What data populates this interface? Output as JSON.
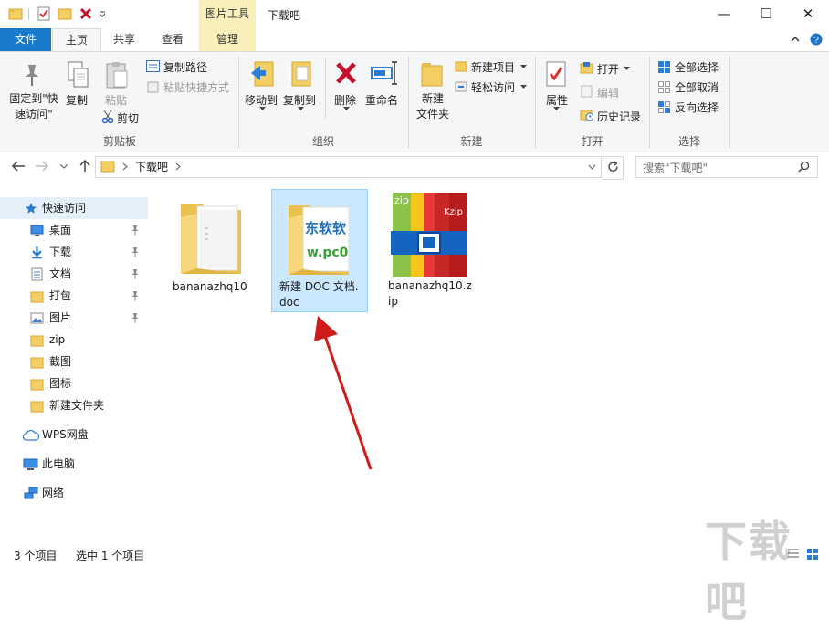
{
  "titlebar": {
    "context_tab": "图片工具",
    "window_title": "下载吧",
    "minimize_glyph": "—",
    "maximize_glyph": "☐",
    "close_glyph": "✕"
  },
  "tabs": {
    "file": "文件",
    "home": "主页",
    "share": "共享",
    "view": "查看",
    "manage": "管理"
  },
  "ribbon": {
    "pin": "固定到\"快速访问\"",
    "copy": "复制",
    "paste": "粘贴",
    "copy_path": "复制路径",
    "paste_shortcut": "粘贴快捷方式",
    "cut": "剪切",
    "group_clipboard": "剪贴板",
    "move_to": "移动到",
    "copy_to": "复制到",
    "delete": "删除",
    "rename": "重命名",
    "group_organize": "组织",
    "new_folder": "新建\n文件夹",
    "new_item": "新建项目",
    "easy_access": "轻松访问",
    "group_new": "新建",
    "properties": "属性",
    "open": "打开",
    "edit": "编辑",
    "history": "历史记录",
    "group_open": "打开",
    "select_all": "全部选择",
    "select_none": "全部取消",
    "invert_selection": "反向选择",
    "group_select": "选择"
  },
  "address": {
    "path": "下载吧",
    "search_placeholder": "搜索\"下载吧\""
  },
  "nav": {
    "quick_access": "快速访问",
    "items": [
      {
        "label": "桌面",
        "pinned": true,
        "icon": "desktop-icon"
      },
      {
        "label": "下载",
        "pinned": true,
        "icon": "download-icon"
      },
      {
        "label": "文档",
        "pinned": true,
        "icon": "document-icon"
      },
      {
        "label": "打包",
        "pinned": true,
        "icon": "folder-icon"
      },
      {
        "label": "图片",
        "pinned": true,
        "icon": "picture-icon"
      },
      {
        "label": "zip",
        "pinned": false,
        "icon": "folder-icon"
      },
      {
        "label": "截图",
        "pinned": false,
        "icon": "folder-icon"
      },
      {
        "label": "图标",
        "pinned": false,
        "icon": "folder-icon"
      },
      {
        "label": "新建文件夹",
        "pinned": false,
        "icon": "folder-icon"
      }
    ],
    "wps": "WPS网盘",
    "this_pc": "此电脑",
    "network": "网络"
  },
  "files": [
    {
      "name": "bananazhq10",
      "type": "folder",
      "selected": false
    },
    {
      "name": "新建 DOC 文档.doc",
      "type": "doc-folder",
      "selected": true,
      "thumb_text_1": "东软软",
      "thumb_text_2": "w.pc0"
    },
    {
      "name": "bananazhq10.zip",
      "type": "zip",
      "selected": false,
      "zip_label_left": "zip",
      "zip_label_right": "Kzip"
    }
  ],
  "status": {
    "count": "3 个项目",
    "selected": "选中 1 个项目"
  },
  "watermark": {
    "text": "下载吧"
  },
  "colors": {
    "accent": "#1979ca",
    "context_tab": "#f8efbb",
    "selection": "#cce8ff",
    "arrow": "#d11a1a"
  }
}
